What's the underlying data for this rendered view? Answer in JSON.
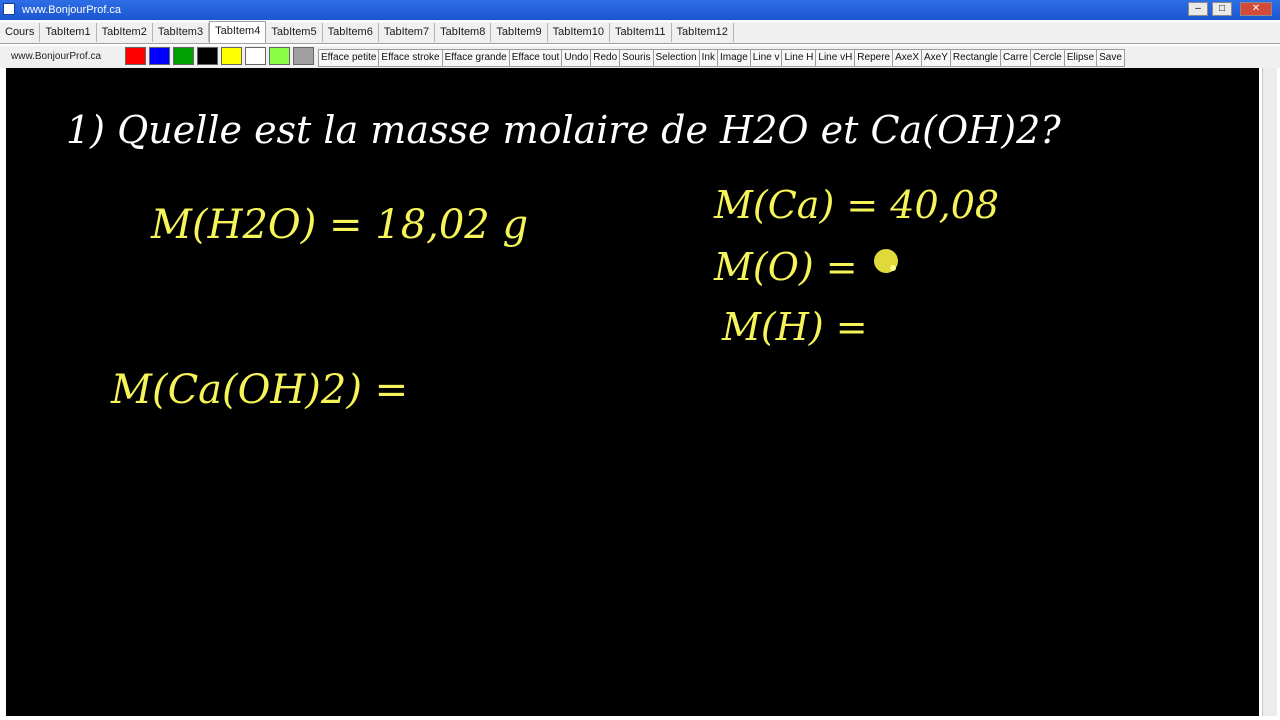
{
  "window": {
    "title": "www.BonjourProf.ca"
  },
  "tabs": [
    "Cours",
    "TabItem1",
    "TabItem2",
    "TabItem3",
    "TabItem4",
    "TabItem5",
    "TabItem6",
    "TabItem7",
    "TabItem8",
    "TabItem9",
    "TabItem10",
    "TabItem11",
    "TabItem12"
  ],
  "active_tab": "TabItem4",
  "toolbar": {
    "site_link": "www.BonjourProf.ca",
    "colors": [
      "#ff0000",
      "#0000ff",
      "#00a000",
      "#000000",
      "#ffff00",
      "#ffffff",
      "#88ff44",
      "#a0a0a0"
    ],
    "tools": [
      "Efface petite",
      "Efface stroke",
      "Efface grande",
      "Efface tout",
      "Undo",
      "Redo",
      "Souris",
      "Selection",
      "Ink",
      "Image",
      "Line v",
      "Line H",
      "Line vH",
      "Repere",
      "AxeX",
      "AxeY",
      "Rectangle",
      "Carre",
      "Cercle",
      "Elipse",
      "Save"
    ]
  },
  "board": {
    "background": "#000000",
    "ink_white": "#ffffff",
    "ink_yellow": "#f5f55a",
    "question": "1) Quelle est la masse molaire de H2O et Ca(OH)2?",
    "line_h2o": "M(H2O) = 18,02 g",
    "line_caoh2": "M(Ca(OH)2) =",
    "line_ca": "M(Ca) = 40,08",
    "line_o": "M(O) =",
    "line_h": "M(H) ="
  }
}
